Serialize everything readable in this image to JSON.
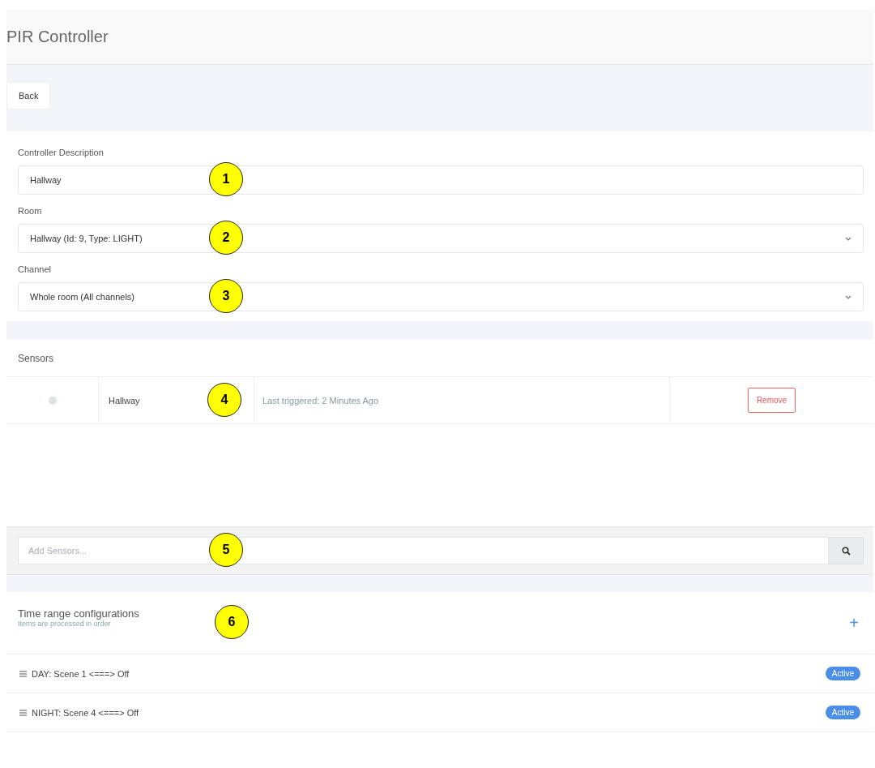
{
  "page_title": "PIR Controller",
  "back_button": "Back",
  "form": {
    "fields": [
      {
        "kind": "text",
        "label": "Controller Description",
        "value": "Hallway",
        "callout": "1"
      },
      {
        "kind": "select",
        "label": "Room",
        "value": "Hallway (Id: 9, Type: LIGHT)",
        "callout": "2"
      },
      {
        "kind": "select",
        "label": "Channel",
        "value": "Whole room (All channels)",
        "callout": "3"
      }
    ]
  },
  "sensors": {
    "title": "Sensors",
    "rows": [
      {
        "color": "#dde3e3",
        "name": "Hallway",
        "last_triggered": "Last triggered: 2 Minutes Ago",
        "action": "Remove",
        "callout": "4"
      }
    ]
  },
  "add_sensors": {
    "placeholder": "Add Sensors...",
    "callout": "5"
  },
  "time_ranges": {
    "title": "Time range configurations",
    "subtitle": "Items are processed in order",
    "add_symbol": "+",
    "callout": "6",
    "items": [
      {
        "label": "DAY: Scene 1 <===> Off",
        "status": "Active"
      },
      {
        "label": "NIGHT: Scene 4 <===> Off",
        "status": "Active"
      }
    ]
  }
}
